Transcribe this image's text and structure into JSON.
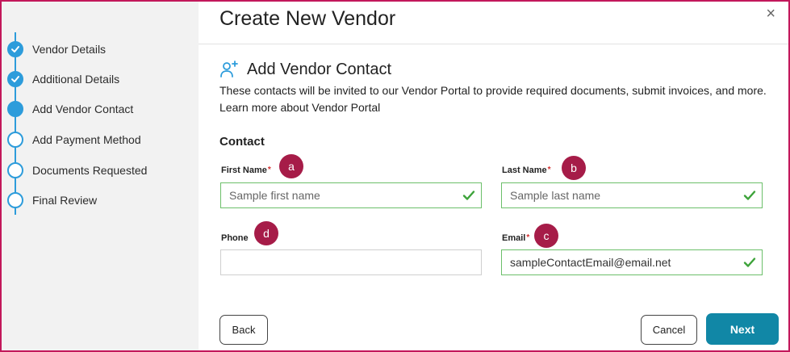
{
  "sidebar": {
    "steps": [
      {
        "label": "Vendor Details",
        "state": "done"
      },
      {
        "label": "Additional Details",
        "state": "done"
      },
      {
        "label": "Add Vendor Contact",
        "state": "current"
      },
      {
        "label": "Add Payment Method",
        "state": "pending"
      },
      {
        "label": "Documents Requested",
        "state": "pending"
      },
      {
        "label": "Final Review",
        "state": "pending"
      }
    ]
  },
  "header": {
    "title": "Create New Vendor",
    "close_glyph": "×"
  },
  "section": {
    "title": "Add Vendor Contact",
    "icon": "add-user-icon",
    "description_line1": "These contacts will be invited to our Vendor Portal to provide required documents, submit invoices, and more.",
    "description_line2": "Learn more about Vendor Portal"
  },
  "form": {
    "heading": "Contact",
    "first_name": {
      "label": "First Name",
      "required_mark": "*",
      "placeholder": "Sample first name",
      "value": "",
      "valid": true,
      "badge": "a"
    },
    "last_name": {
      "label": "Last Name",
      "required_mark": "*",
      "placeholder": "Sample last name",
      "value": "",
      "valid": true,
      "badge": "b"
    },
    "phone": {
      "label": "Phone",
      "placeholder": "",
      "value": "",
      "valid": false,
      "badge": "d"
    },
    "email": {
      "label": "Email",
      "required_mark": "*",
      "placeholder": "",
      "value": "sampleContactEmail@email.net",
      "valid": true,
      "badge": "c"
    }
  },
  "footer": {
    "back_label": "Back",
    "cancel_label": "Cancel",
    "next_label": "Next"
  },
  "colors": {
    "accent": "#2d9cdb",
    "primary_button": "#1187a6",
    "badge": "#a61c48",
    "valid": "#3da33a",
    "frame": "#c2185b"
  }
}
